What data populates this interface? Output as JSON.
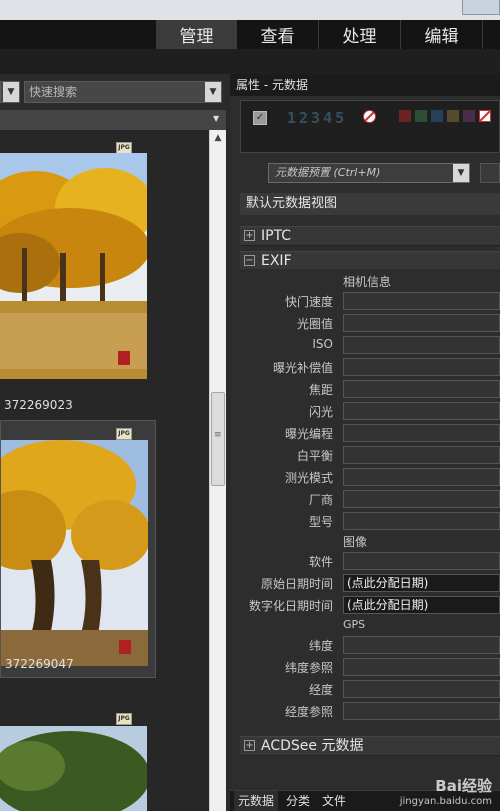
{
  "mode_tabs": [
    "管理",
    "查看",
    "处理",
    "编辑"
  ],
  "left_toolbar": {
    "search_placeholder": "快速搜索"
  },
  "thumbnails": [
    {
      "name": "372269023",
      "badge": "JPG"
    },
    {
      "name": "372269047",
      "badge": "JPG"
    },
    {
      "name": "",
      "badge": "JPG"
    }
  ],
  "panel": {
    "title": "属性 - 元数据",
    "rating_numbers": "12345",
    "preset_placeholder": "元数据预置 (Ctrl+M)",
    "default_view": "默认元数据视图",
    "sections": {
      "iptc": "IPTC",
      "exif": "EXIF",
      "acdsee": "ACDSee 元数据"
    },
    "subheaders": {
      "camera": "相机信息",
      "image": "图像",
      "gps": "GPS"
    },
    "fields": [
      {
        "label": "快门速度",
        "value": ""
      },
      {
        "label": "光圈值",
        "value": ""
      },
      {
        "label": "ISO",
        "value": ""
      },
      {
        "label": "曝光补偿值",
        "value": ""
      },
      {
        "label": "焦距",
        "value": ""
      },
      {
        "label": "闪光",
        "value": ""
      },
      {
        "label": "曝光编程",
        "value": ""
      },
      {
        "label": "白平衡",
        "value": ""
      },
      {
        "label": "测光模式",
        "value": ""
      },
      {
        "label": "厂商",
        "value": ""
      },
      {
        "label": "型号",
        "value": ""
      },
      {
        "label": "软件",
        "value": ""
      },
      {
        "label": "原始日期时间",
        "value": "(点此分配日期)"
      },
      {
        "label": "数字化日期时间",
        "value": "(点此分配日期)"
      },
      {
        "label": "纬度",
        "value": ""
      },
      {
        "label": "纬度参照",
        "value": ""
      },
      {
        "label": "经度",
        "value": ""
      },
      {
        "label": "经度参照",
        "value": ""
      }
    ],
    "bottom_tabs": [
      "元数据",
      "分类",
      "文件"
    ]
  },
  "watermark": {
    "brand": "Bai经验",
    "url": "jingyan.baidu.com"
  }
}
